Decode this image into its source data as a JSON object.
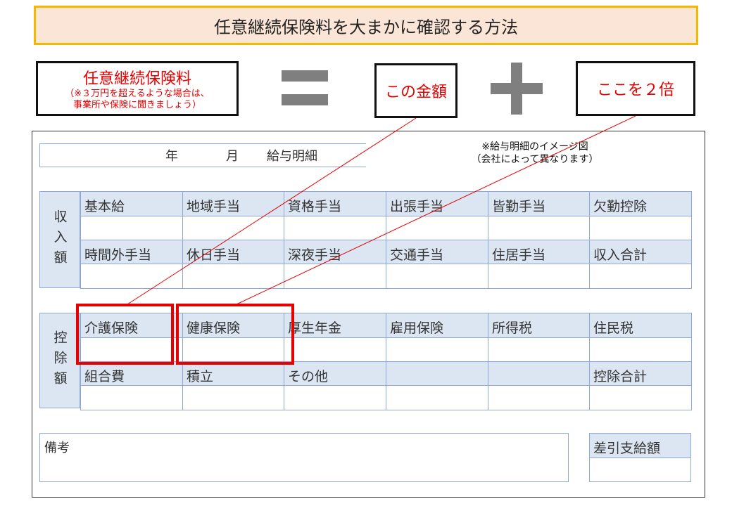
{
  "title": "任意継続保険料を大まかに確認する方法",
  "formula": {
    "premium": {
      "label": "任意継続保険料",
      "note": "（※３万円を超えるような場合は、\n事業所や保険に聞きましょう）"
    },
    "equals_symbol": "equals",
    "amount_box": "この金額",
    "plus_symbol": "plus",
    "double_box": "ここを２倍"
  },
  "slip": {
    "title_year": "年",
    "title_month": "月",
    "title_text": "給与明細",
    "image_note": "※給与明細のイメージ図\n（会社によって異なります）",
    "income": {
      "label": "収入額",
      "row1": [
        "基本給",
        "地域手当",
        "資格手当",
        "出張手当",
        "皆勤手当",
        "欠勤控除"
      ],
      "row2": [
        "時間外手当",
        "休日手当",
        "深夜手当",
        "交通手当",
        "住居手当",
        "収入合計"
      ]
    },
    "deduction": {
      "label": "控除額",
      "row1": [
        "介護保険",
        "健康保険",
        "厚生年金",
        "雇用保険",
        "所得税",
        "住民税"
      ],
      "row2": [
        "組合費",
        "積立",
        "その他",
        "",
        "",
        "控除合計"
      ]
    },
    "remarks_label": "備考",
    "net_pay_label": "差引支給額"
  },
  "colors": {
    "title_bg": "#fbe5d6",
    "title_border": "#f5b800",
    "accent_red": "#e60000",
    "header_cell": "#dce6f2",
    "cell_border": "#8ea9d8",
    "symbol_gray": "#7f7f7f"
  }
}
